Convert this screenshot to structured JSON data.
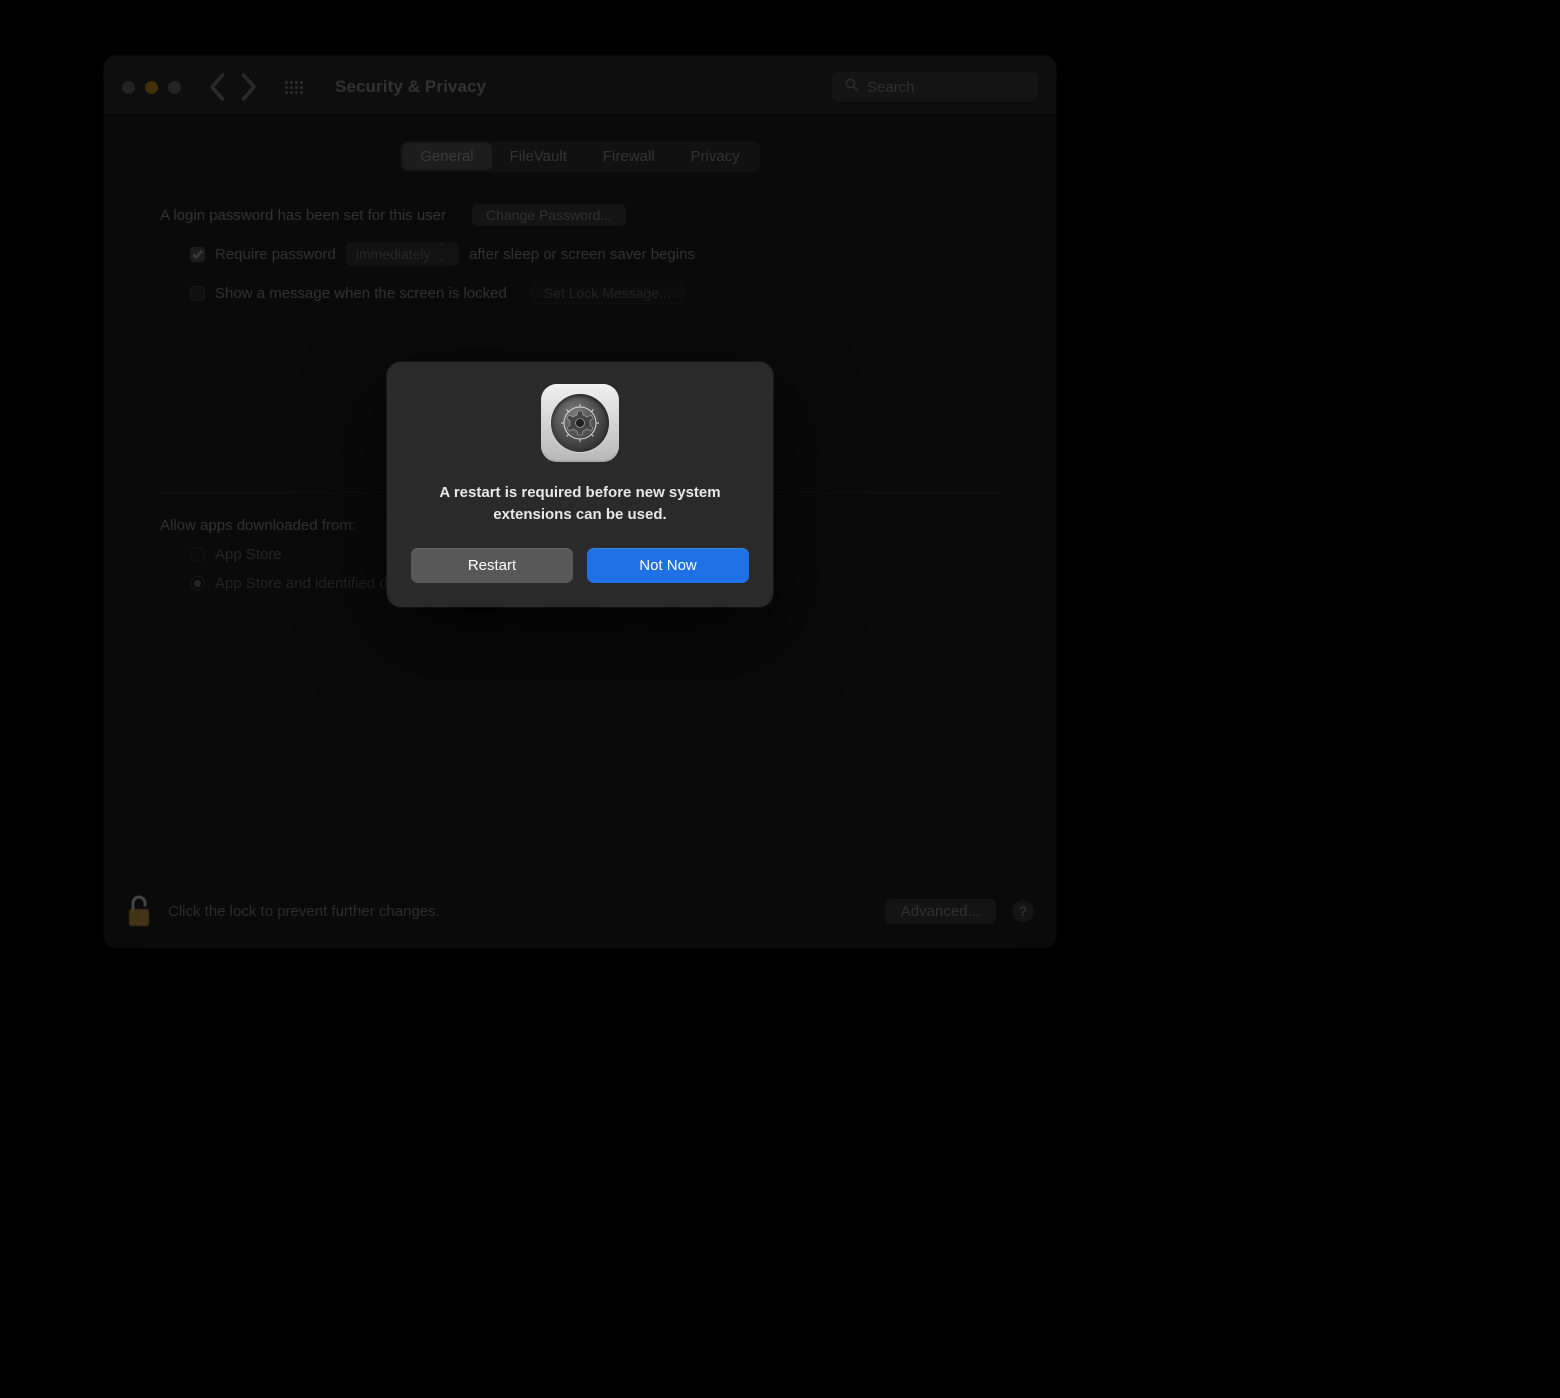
{
  "window": {
    "title": "Security & Privacy",
    "search_placeholder": "Search"
  },
  "tabs": {
    "items": [
      "General",
      "FileVault",
      "Firewall",
      "Privacy"
    ],
    "selected": 0
  },
  "general": {
    "login_password_label": "A login password has been set for this user",
    "change_password_btn": "Change Password...",
    "require_password_label": "Require password",
    "delay_selected": "immediately",
    "after_sleep_label": "after sleep or screen saver begins",
    "show_message_label": "Show a message when the screen is locked",
    "set_lock_message_btn": "Set Lock Message...",
    "allow_apps_label": "Allow apps downloaded from:",
    "radio_options": [
      "App Store",
      "App Store and identified developers"
    ],
    "radio_selected": 1
  },
  "footer": {
    "lock_text": "Click the lock to prevent further changes.",
    "advanced_btn": "Advanced...",
    "help": "?"
  },
  "modal": {
    "message": "A restart is required before new system extensions can be used.",
    "restart_label": "Restart",
    "not_now_label": "Not Now"
  }
}
